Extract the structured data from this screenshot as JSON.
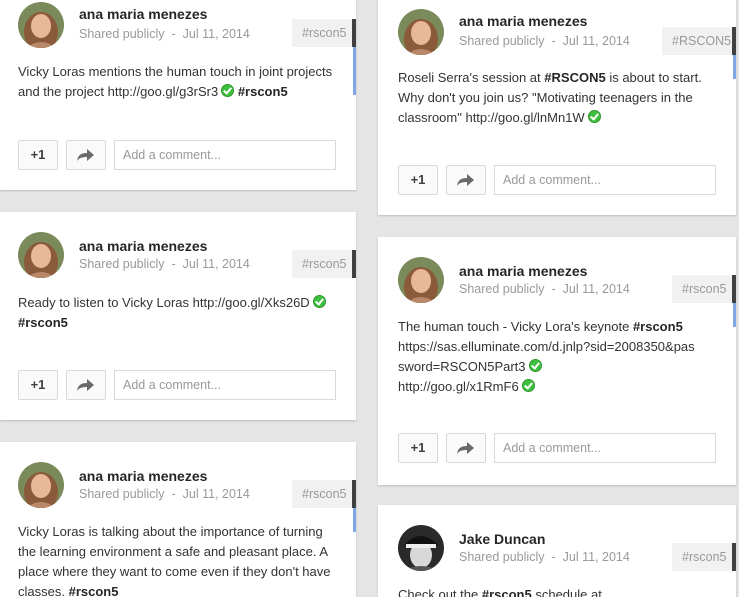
{
  "posts": [
    {
      "author": "ana maria menezes",
      "visibility": "Shared publicly",
      "date": "Jul 11, 2014",
      "tag": "#rscon5",
      "text_parts": [
        "Vicky Loras mentions the human touch in joint projects and the project http://goo.gl/g3rSr3",
        "#rscon5"
      ],
      "plus_one": "+1",
      "comment_placeholder": "Add a comment..."
    },
    {
      "author": "ana maria menezes",
      "visibility": "Shared publicly",
      "date": "Jul 11, 2014",
      "tag": "#rscon5",
      "text_parts": [
        "Ready to listen to Vicky Loras http://goo.gl/Xks26D",
        "#rscon5"
      ],
      "plus_one": "+1",
      "comment_placeholder": "Add a comment..."
    },
    {
      "author": "ana maria menezes",
      "visibility": "Shared publicly",
      "date": "Jul 11, 2014",
      "tag": "#rscon5",
      "text_parts": [
        "Vicky Loras is talking about the importance of turning the learning environment a safe and pleasant place. A place where they want to come even if they don't have classes.",
        "#rscon5"
      ]
    },
    {
      "author": "ana maria menezes",
      "visibility": "Shared publicly",
      "date": "Jul 11, 2014",
      "tag": "#RSCON5",
      "text_parts": [
        "Roseli Serra's session at",
        "#RSCON5",
        "is about to start. Why don't you join us? \"Motivating teenagers in the classroom\" http://goo.gl/lnMn1W"
      ],
      "plus_one": "+1",
      "comment_placeholder": "Add a comment..."
    },
    {
      "author": "ana maria menezes",
      "visibility": "Shared publicly",
      "date": "Jul 11, 2014",
      "tag": "#rscon5",
      "text_parts": [
        "The human touch - Vicky Lora's keynote",
        "#rscon5",
        "https://sas.elluminate.com/d.jnlp?sid=2008350&password=RSCON5Part3",
        "http://goo.gl/x1RmF6"
      ],
      "plus_one": "+1",
      "comment_placeholder": "Add a comment..."
    },
    {
      "author": "Jake Duncan",
      "visibility": "Shared publicly",
      "date": "Jul 11, 2014",
      "tag": "#rscon5",
      "text_parts": [
        "Check out the",
        "#rscon5",
        "schedule at"
      ]
    }
  ],
  "meta_separator": "-",
  "colors": {
    "background": "#e5e5e5",
    "card": "#ffffff",
    "accent_blue": "#7fa6e8",
    "check_green": "#3fbf3f",
    "tag_border": "#404040"
  },
  "icons": {
    "share": "share-arrow-icon",
    "verified": "green-check-icon"
  }
}
